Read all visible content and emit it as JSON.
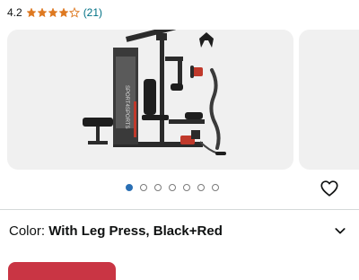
{
  "rating": {
    "value": "4.2",
    "count": "(21)",
    "stars_filled": 4,
    "stars_total": 5
  },
  "carousel": {
    "total_images": 7,
    "active_index": 0,
    "image_description_icon": "home-gym-product-image"
  },
  "color": {
    "label": "Color: ",
    "value": "With Leg Press, Black+Red"
  },
  "icons": {
    "wishlist": "heart-outline-icon",
    "expand": "chevron-down-icon"
  },
  "colors": {
    "link": "#007185",
    "star": "#de7921",
    "dot_active": "#2a6fb4",
    "cta": "#c93544",
    "card_bg": "#f0f0f0"
  }
}
